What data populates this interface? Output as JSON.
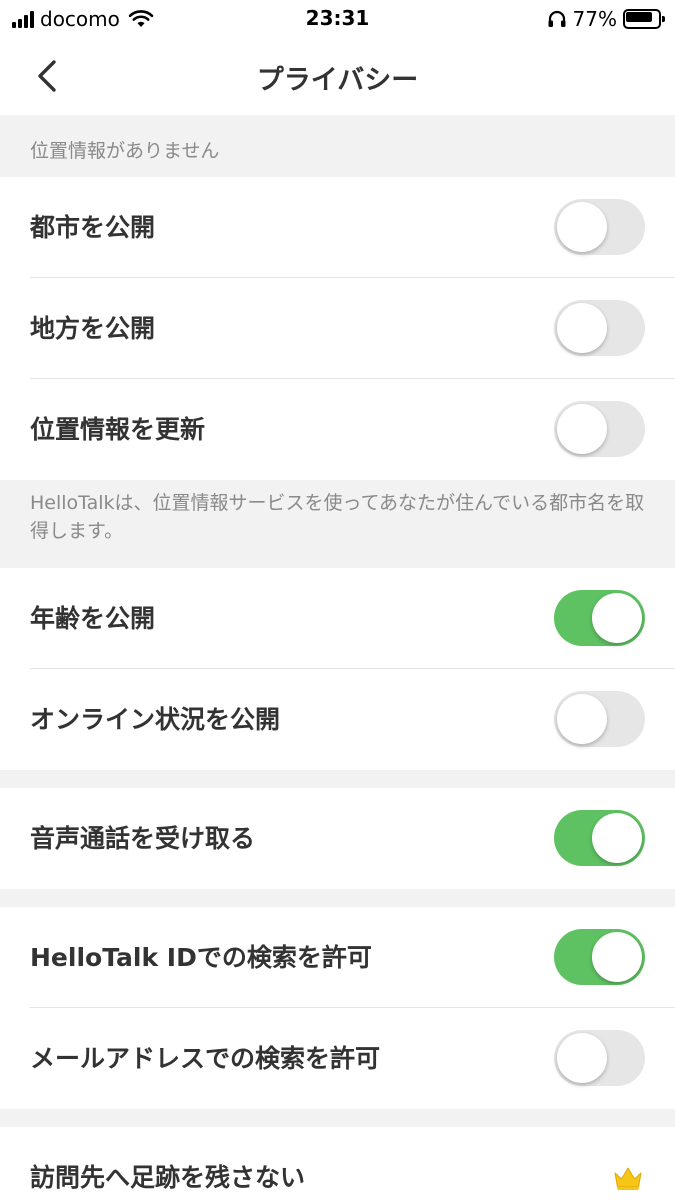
{
  "status_bar": {
    "carrier": "docomo",
    "time": "23:31",
    "battery_percent": "77%"
  },
  "nav": {
    "title": "プライバシー",
    "back_icon": "chevron-left-icon"
  },
  "location_section": {
    "header": "位置情報がありません",
    "items": [
      {
        "label": "都市を公開",
        "enabled": false
      },
      {
        "label": "地方を公開",
        "enabled": false
      },
      {
        "label": "位置情報を更新",
        "enabled": false
      }
    ],
    "footer": "HelloTalkは、位置情報サービスを使ってあなたが住んでいる都市名を取得します。"
  },
  "profile_section": {
    "items": [
      {
        "label": "年齢を公開",
        "enabled": true
      },
      {
        "label": "オンライン状況を公開",
        "enabled": false
      }
    ]
  },
  "call_section": {
    "items": [
      {
        "label": "音声通話を受け取る",
        "enabled": true
      }
    ]
  },
  "search_section": {
    "items": [
      {
        "label": "HelloTalk IDでの検索を許可",
        "enabled": true
      },
      {
        "label": "メールアドレスでの検索を許可",
        "enabled": false
      }
    ]
  },
  "visit_section": {
    "items": [
      {
        "label": "訪問先へ足跡を残さない",
        "icon": "crown-icon"
      }
    ]
  },
  "colors": {
    "toggle_on": "#5ec262",
    "toggle_off": "#e6e6e6",
    "crown": "#f5c518",
    "background": "#f2f2f2"
  }
}
